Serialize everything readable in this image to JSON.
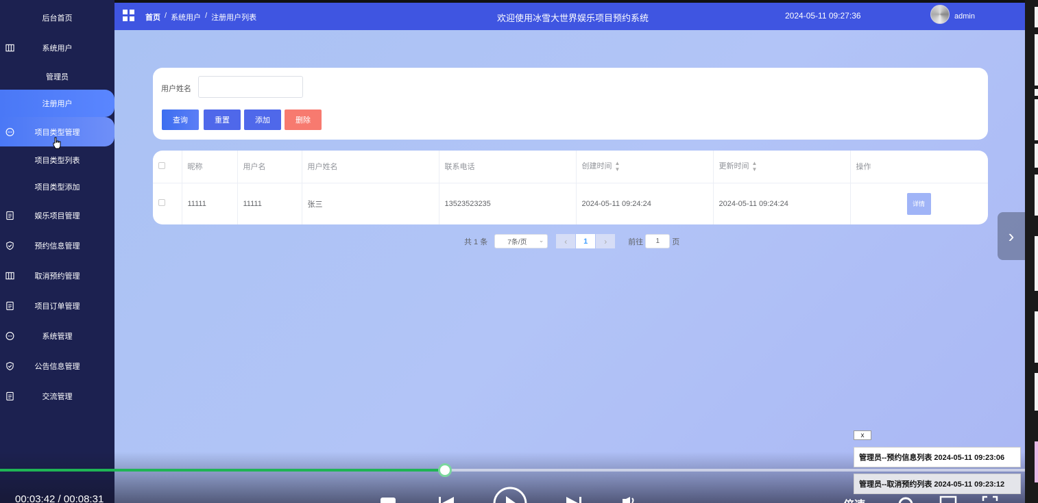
{
  "sidebar": {
    "items": [
      {
        "label": "后台首页",
        "icon": "",
        "state": ""
      },
      {
        "label": "系统用户",
        "icon": "columns-icon",
        "state": ""
      },
      {
        "label": "管理员",
        "icon": "",
        "state": ""
      },
      {
        "label": "注册用户",
        "icon": "",
        "state": "active"
      },
      {
        "label": "项目类型管理",
        "icon": "chat-icon",
        "state": "active"
      },
      {
        "label": "项目类型列表",
        "icon": "",
        "state": ""
      },
      {
        "label": "项目类型添加",
        "icon": "",
        "state": ""
      },
      {
        "label": "娱乐项目管理",
        "icon": "document-icon",
        "state": ""
      },
      {
        "label": "预约信息管理",
        "icon": "shield-icon",
        "state": ""
      },
      {
        "label": "取消预约管理",
        "icon": "columns-icon",
        "state": ""
      },
      {
        "label": "项目订单管理",
        "icon": "document-icon",
        "state": ""
      },
      {
        "label": "系统管理",
        "icon": "chat-icon",
        "state": ""
      },
      {
        "label": "公告信息管理",
        "icon": "shield-icon",
        "state": ""
      },
      {
        "label": "交流管理",
        "icon": "document-icon",
        "state": ""
      }
    ]
  },
  "header": {
    "breadcrumb": [
      "首页",
      "/",
      "系统用户",
      "/",
      "注册用户列表"
    ],
    "title": "欢迎使用冰雪大世界娱乐项目预约系统",
    "datetime": "2024-05-11 09:27:36",
    "username": "admin"
  },
  "search": {
    "label": "用户姓名",
    "input_value": "",
    "buttons": {
      "query": "查询",
      "reset": "重置",
      "add": "添加",
      "delete": "删除"
    }
  },
  "table": {
    "columns": [
      "昵称",
      "用户名",
      "用户姓名",
      "联系电话",
      "创建时间",
      "更新时间",
      "操作"
    ],
    "rows": [
      {
        "nickname": "11111",
        "username": "11111",
        "realname": "张三",
        "phone": "13523523235",
        "created": "2024-05-11 09:24:24",
        "updated": "2024-05-11 09:24:24",
        "action": "详情"
      }
    ]
  },
  "pagination": {
    "total": "共 1 条",
    "page_size": "7条/页",
    "current_page": "1",
    "goto_label": "前往",
    "goto_value": "1",
    "page_unit": "页"
  },
  "notifications": {
    "close": "x",
    "items": [
      "管理员--预约信息列表 2024-05-11 09:23:06",
      "管理员--取消预约列表 2024-05-11 09:23:12"
    ]
  },
  "player": {
    "time": "00:03:42 / 00:08:31",
    "progress": 0.434,
    "speed_label": "倍速"
  },
  "colors": {
    "sidebar_bg": "#1c2150",
    "header_bg": "#3f55e1",
    "accent": "#4f68ea",
    "danger": "#f77a6f",
    "progress": "#1fb455"
  }
}
